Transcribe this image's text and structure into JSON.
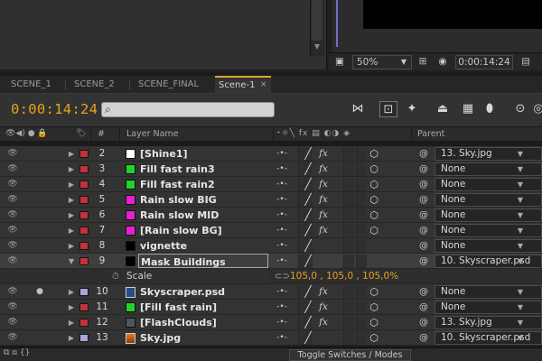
{
  "viewer": {
    "zoom": "50%",
    "timecode": "0:00:14:24"
  },
  "tabs": [
    {
      "label": "SCENE_1",
      "active": false
    },
    {
      "label": "SCENE_2",
      "active": false
    },
    {
      "label": "SCENE_FINAL",
      "active": false
    },
    {
      "label": "Scene-1",
      "active": true
    }
  ],
  "timeline": {
    "current_time": "0:00:14:24",
    "search_placeholder": ""
  },
  "columns": {
    "number": "#",
    "layer_name": "Layer Name",
    "parent": "Parent"
  },
  "layers": [
    {
      "num": "2",
      "name": "[Shine1]",
      "label_color": "#c0333a",
      "swatch": "#ffffff",
      "parent": "13. Sky.jpg",
      "pen": true,
      "fx": true
    },
    {
      "num": "3",
      "name": "Fill fast rain3",
      "label_color": "#c0333a",
      "swatch": "#1fd52a",
      "parent": "None",
      "pen": true,
      "fx": true
    },
    {
      "num": "4",
      "name": "Fill fast rain2",
      "label_color": "#c0333a",
      "swatch": "#1fd52a",
      "parent": "None",
      "pen": true,
      "fx": true
    },
    {
      "num": "5",
      "name": "Rain slow BIG",
      "label_color": "#c0333a",
      "swatch": "#e51fd5",
      "parent": "None",
      "pen": true,
      "fx": true
    },
    {
      "num": "6",
      "name": "Rain slow MID",
      "label_color": "#c0333a",
      "swatch": "#e51fd5",
      "parent": "None",
      "pen": true,
      "fx": true
    },
    {
      "num": "7",
      "name": "[Rain slow BG]",
      "label_color": "#c0333a",
      "swatch": "#e51fd5",
      "parent": "None",
      "pen": true,
      "fx": true
    },
    {
      "num": "8",
      "name": "vignette",
      "label_color": "#c0333a",
      "swatch": "#000000",
      "parent": "None",
      "pen": true,
      "fx": false
    },
    {
      "num": "9",
      "name": "Mask Buildings",
      "label_color": "#c0333a",
      "swatch": "#000000",
      "parent": "10. Skyscraper.psd",
      "pen": true,
      "fx": false,
      "expanded": true,
      "selected": true
    }
  ],
  "scale_property": {
    "label": "Scale",
    "value": "105,0 , 105,0 , 105,0%"
  },
  "layers_after": [
    {
      "num": "10",
      "name": "Skyscraper.psd",
      "label_color": "#a6a6d8",
      "swatch": "psd",
      "parent": "None",
      "pen": true,
      "fx": true
    },
    {
      "num": "11",
      "name": "[Fill fast rain]",
      "label_color": "#c0333a",
      "swatch": "#1fd52a",
      "parent": "None",
      "pen": true,
      "fx": true
    },
    {
      "num": "12",
      "name": "[FlashClouds]",
      "label_color": "#c0333a",
      "swatch": "#555555",
      "parent": "13. Sky.jpg",
      "pen": true,
      "fx": true
    },
    {
      "num": "13",
      "name": "Sky.jpg",
      "label_color": "#a6a6d8",
      "swatch": "jpg",
      "parent": "10. Skyscraper.psd",
      "pen": true,
      "fx": false
    }
  ],
  "footer": {
    "toggle_label": "Toggle Switches / Modes"
  },
  "colors": {
    "accent_orange": "#e8a21f",
    "label_red": "#c0333a",
    "label_lavender": "#a6a6d8"
  }
}
